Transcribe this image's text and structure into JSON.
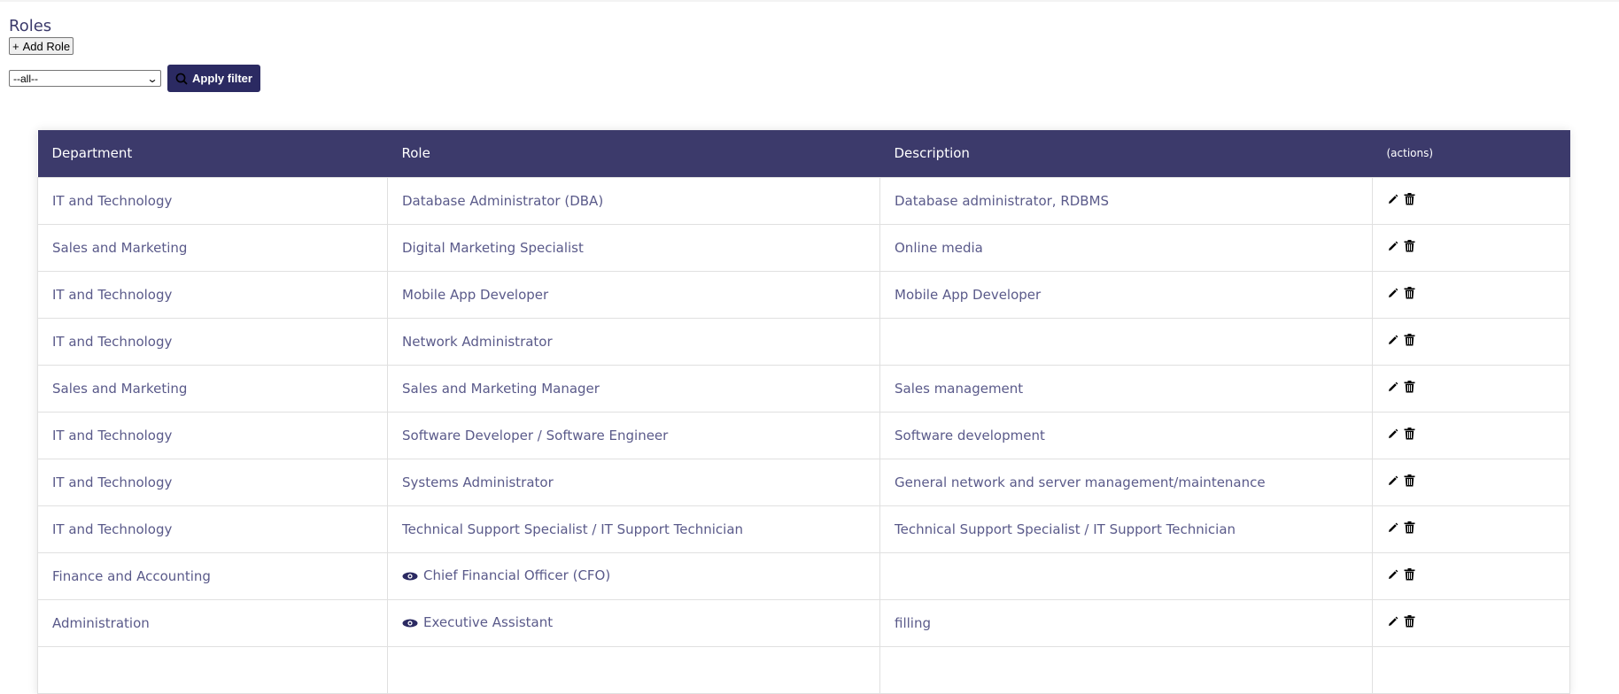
{
  "page": {
    "title": "Roles"
  },
  "toolbar": {
    "add_label": "Add Role"
  },
  "filter": {
    "selected": "--all--",
    "apply_label": "Apply filter"
  },
  "table": {
    "columns": [
      "Department",
      "Role",
      "Description",
      "(actions)"
    ],
    "rows": [
      {
        "department": "IT and Technology",
        "role": "Database Administrator (DBA)",
        "description": "Database administrator, RDBMS",
        "eye": false
      },
      {
        "department": "Sales and Marketing",
        "role": "Digital Marketing Specialist",
        "description": "Online media",
        "eye": false
      },
      {
        "department": "IT and Technology",
        "role": "Mobile App Developer",
        "description": "Mobile App Developer",
        "eye": false
      },
      {
        "department": "IT and Technology",
        "role": "Network Administrator",
        "description": "",
        "eye": false
      },
      {
        "department": "Sales and Marketing",
        "role": "Sales and Marketing Manager",
        "description": "Sales management",
        "eye": false
      },
      {
        "department": "IT and Technology",
        "role": "Software Developer / Software Engineer",
        "description": "Software development",
        "eye": false
      },
      {
        "department": "IT and Technology",
        "role": "Systems Administrator",
        "description": "General network and server management/maintenance",
        "eye": false
      },
      {
        "department": "IT and Technology",
        "role": "Technical Support Specialist / IT Support Technician",
        "description": "Technical Support Specialist / IT Support Technician",
        "eye": false
      },
      {
        "department": "Finance and Accounting",
        "role": "Chief Financial Officer (CFO)",
        "description": "",
        "eye": true
      },
      {
        "department": "Administration",
        "role": "Executive Assistant",
        "description": "filling",
        "eye": true
      },
      {
        "department": "",
        "role": "",
        "description": "",
        "eye": false
      }
    ]
  },
  "icons": {
    "add": "plus-icon",
    "apply": "search-icon",
    "edit": "pencil-icon",
    "delete": "trash-icon",
    "view": "eye-icon"
  },
  "colors": {
    "header_bg": "#3c3a6b",
    "button_bg": "#2b2a62",
    "text": "#5a5a8a"
  }
}
